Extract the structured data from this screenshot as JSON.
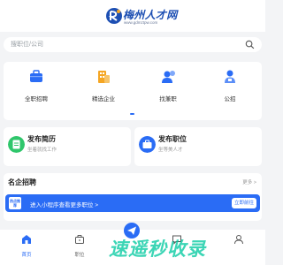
{
  "header": {
    "logo": {
      "name": "梅州人才网",
      "url": "www.gdmztpw.com",
      "icon": "job-logo-icon"
    }
  },
  "search": {
    "placeholder": "搜职位/公司",
    "icon": "search-icon"
  },
  "nav": {
    "items": [
      {
        "label": "全职招聘",
        "icon": "briefcase-icon",
        "color": "#2a6cf5"
      },
      {
        "label": "精选企业",
        "icon": "building-icon",
        "color": "#f5a623"
      },
      {
        "label": "找兼职",
        "icon": "part-time-icon",
        "color": "#2a6cf5"
      },
      {
        "label": "公招",
        "icon": "person-icon",
        "color": "#2a6cf5"
      }
    ]
  },
  "publish": {
    "resume": {
      "title": "发布简历",
      "subtitle": "坐着就找工作",
      "icon": "resume-icon",
      "color": "#2fc66b"
    },
    "job": {
      "title": "发布职位",
      "subtitle": "坐等美人才",
      "icon": "post-job-icon",
      "color": "#2a6cf5"
    }
  },
  "jobs": {
    "title": "名企招聘",
    "more": "更多 >",
    "banner": {
      "badge": "热点推荐",
      "text": "进入小程序查看更多职位 >",
      "button": "立即前往"
    }
  },
  "tabbar": {
    "items": [
      {
        "label": "首页",
        "icon": "home-icon",
        "active": true
      },
      {
        "label": "职位",
        "icon": "job-icon",
        "active": false
      },
      {
        "label": "",
        "icon": "message-icon",
        "active": false
      },
      {
        "label": "",
        "icon": "user-icon",
        "active": false
      }
    ]
  },
  "watermark": {
    "text": "速遥秒收录",
    "icon": "paper-plane-icon"
  },
  "colors": {
    "accent": "#2a6cf5",
    "watermark": "#04c9a0",
    "background": "#f3f4f6"
  }
}
